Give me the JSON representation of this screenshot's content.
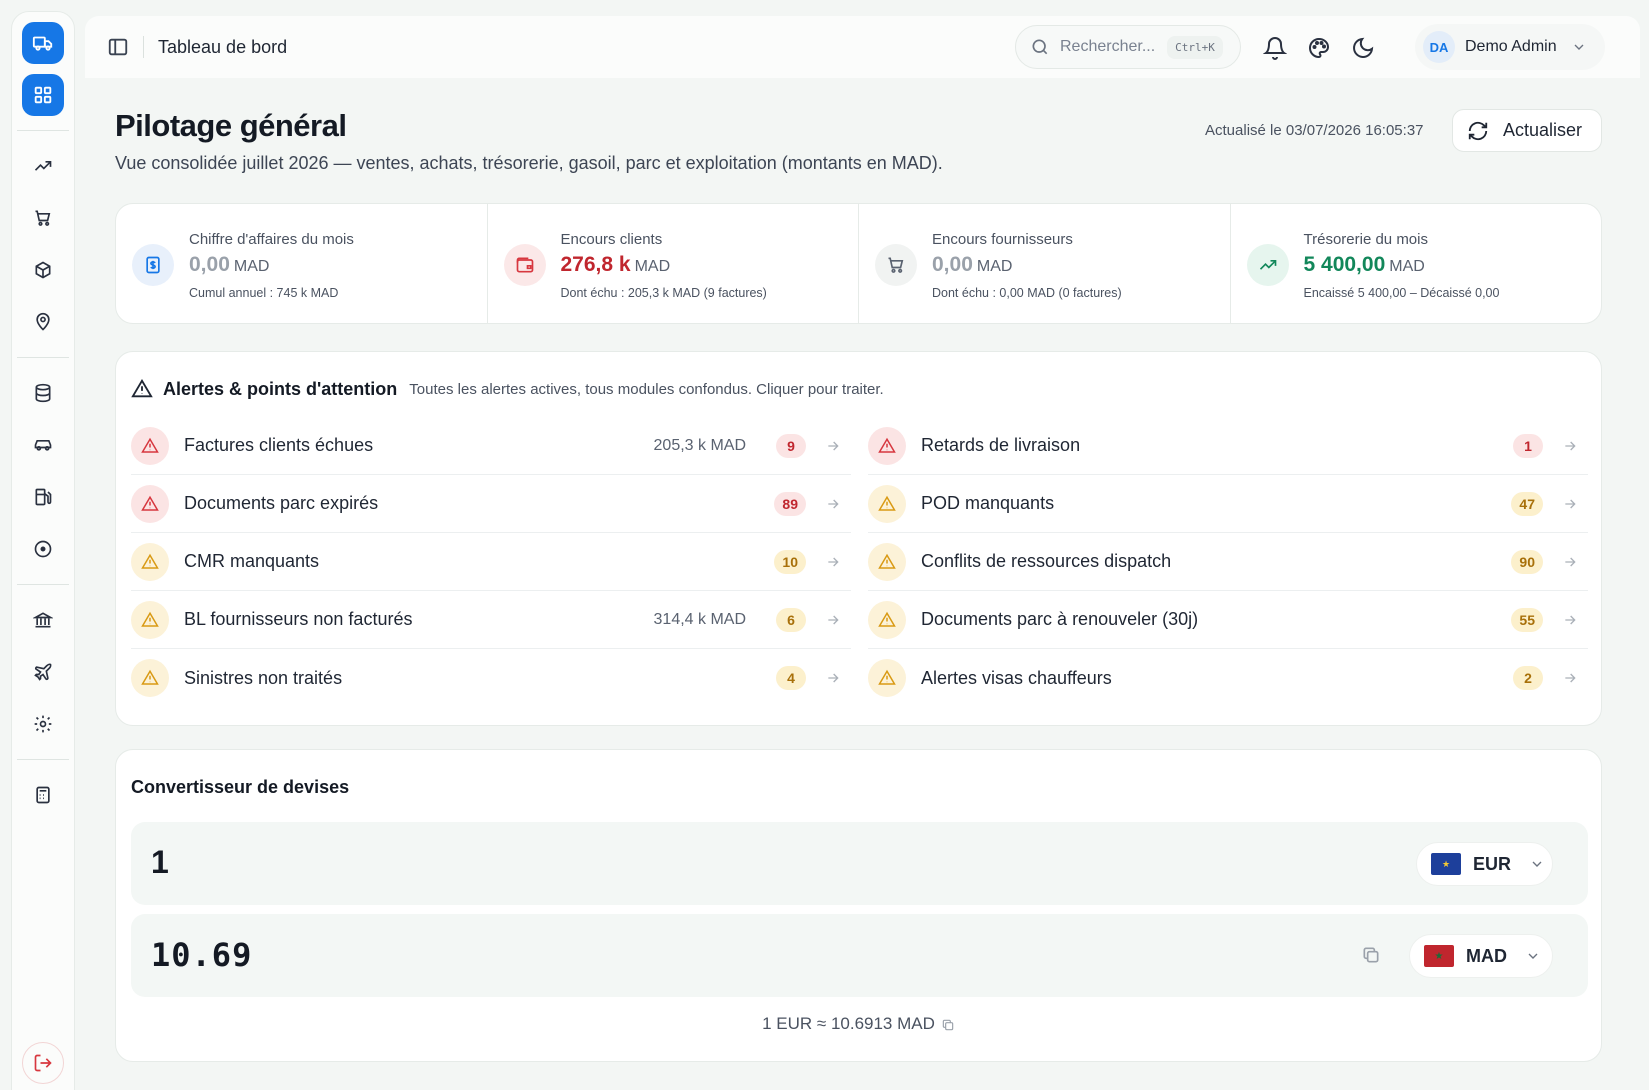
{
  "header": {
    "title": "Tableau de bord",
    "search_placeholder": "Rechercher...",
    "search_shortcut": "Ctrl+K",
    "user_initials": "DA",
    "user_name": "Demo Admin"
  },
  "page": {
    "title": "Pilotage général",
    "subtitle": "Vue consolidée juillet 2026 — ventes, achats, trésorerie, gasoil, parc et exploitation (montants en MAD).",
    "updated": "Actualisé le 03/07/2026 16:05:37",
    "refresh_label": "Actualiser"
  },
  "kpis": [
    {
      "label": "Chiffre d'affaires du mois",
      "value": "0,00",
      "unit": "MAD",
      "note": "Cumul annuel : 745 k MAD",
      "color": "#9aa1aa",
      "icon": "dollar-icon"
    },
    {
      "label": "Encours clients",
      "value": "276,8 k",
      "unit": "MAD",
      "note": "Dont échu : 205,3 k MAD (9 factures)",
      "color": "#c0262e",
      "icon": "wallet-icon"
    },
    {
      "label": "Encours fournisseurs",
      "value": "0,00",
      "unit": "MAD",
      "note": "Dont échu : 0,00 MAD (0 factures)",
      "color": "#9aa1aa",
      "icon": "cart-icon"
    },
    {
      "label": "Trésorerie du mois",
      "value": "5 400,00",
      "unit": "MAD",
      "note": "Encaissé 5 400,00 – Décaissé 0,00",
      "color": "#12875a",
      "icon": "trend-up-icon"
    }
  ],
  "alerts": {
    "title": "Alertes & points d'attention",
    "description": "Toutes les alertes actives, tous modules confondus. Cliquer pour traiter.",
    "left": [
      {
        "label": "Factures clients échues",
        "amount": "205,3 k MAD",
        "count": "9",
        "level": "red"
      },
      {
        "label": "Documents parc expirés",
        "amount": "",
        "count": "89",
        "level": "red"
      },
      {
        "label": "CMR manquants",
        "amount": "",
        "count": "10",
        "level": "amber"
      },
      {
        "label": "BL fournisseurs non facturés",
        "amount": "314,4 k MAD",
        "count": "6",
        "level": "amber"
      },
      {
        "label": "Sinistres non traités",
        "amount": "",
        "count": "4",
        "level": "amber"
      }
    ],
    "right": [
      {
        "label": "Retards de livraison",
        "amount": "",
        "count": "1",
        "level": "red"
      },
      {
        "label": "POD manquants",
        "amount": "",
        "count": "47",
        "level": "amber"
      },
      {
        "label": "Conflits de ressources dispatch",
        "amount": "",
        "count": "90",
        "level": "amber"
      },
      {
        "label": "Documents parc à renouveler (30j)",
        "amount": "",
        "count": "55",
        "level": "amber"
      },
      {
        "label": "Alertes visas chauffeurs",
        "amount": "",
        "count": "2",
        "level": "amber"
      }
    ]
  },
  "converter": {
    "title": "Convertisseur de devises",
    "from_value": "1",
    "from_currency": "EUR",
    "to_value": "10.69",
    "to_currency": "MAD",
    "rate_text": "1 EUR ≈ 10.6913 MAD"
  },
  "colors": {
    "accent": "#1677e6",
    "danger": "#c0262e",
    "warning": "#d99a14",
    "success": "#12875a"
  }
}
